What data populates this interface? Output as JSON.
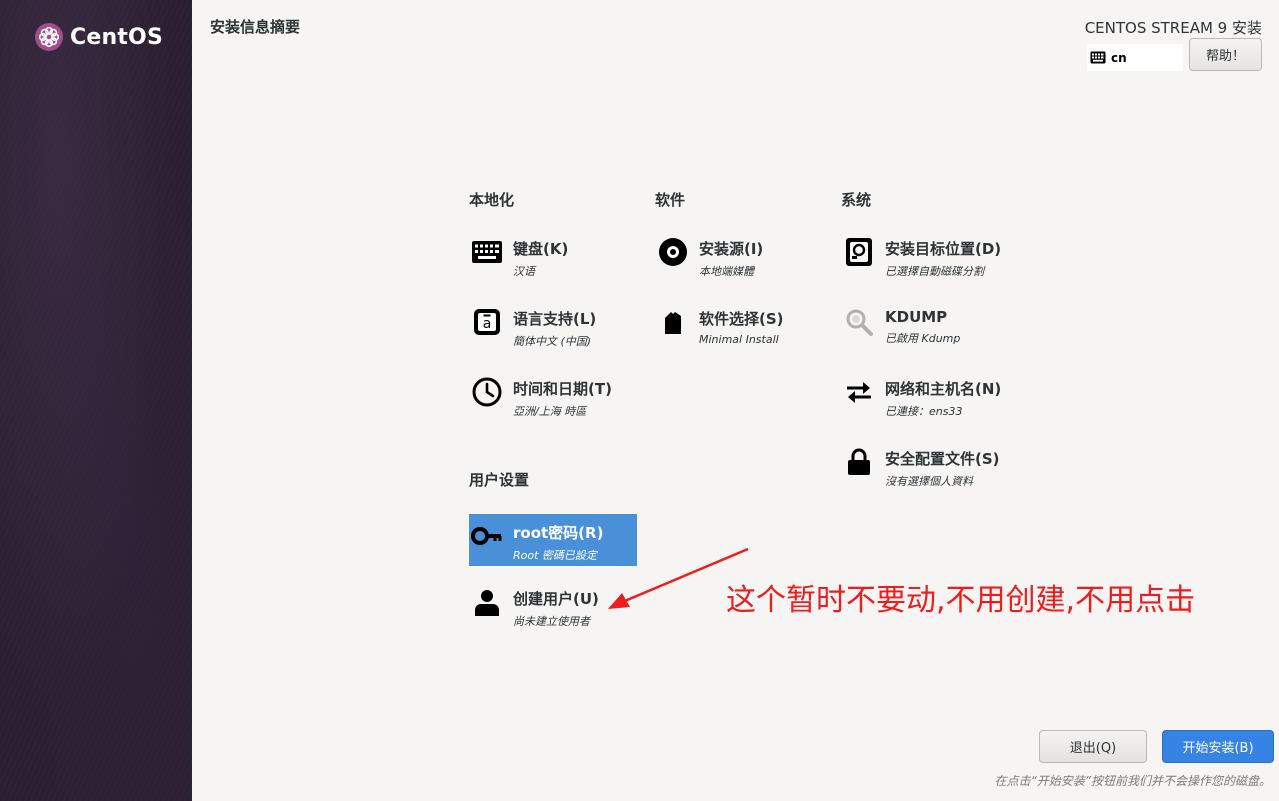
{
  "brand": {
    "name": "CentOS"
  },
  "header": {
    "title": "安装信息摘要",
    "product": "CENTOS STREAM 9 安装",
    "keyboard_layout": "cn",
    "help_label": "帮助！"
  },
  "categories": {
    "localization": {
      "label": "本地化",
      "items": [
        {
          "title": "键盘(K)",
          "status": "汉语",
          "icon": "keyboard-icon"
        },
        {
          "title": "语言支持(L)",
          "status": "簡体中文 (中国)",
          "icon": "language-icon"
        },
        {
          "title": "时间和日期(T)",
          "status": "亞洲/上海 時區",
          "icon": "clock-icon"
        }
      ]
    },
    "software": {
      "label": "软件",
      "items": [
        {
          "title": "安装源(I)",
          "status": "本地端媒體",
          "icon": "disc-icon"
        },
        {
          "title": "软件选择(S)",
          "status": "Minimal Install",
          "icon": "package-icon"
        }
      ]
    },
    "system": {
      "label": "系统",
      "items": [
        {
          "title": "安装目标位置(D)",
          "status": "已選擇自動磁碟分割",
          "icon": "harddisk-icon"
        },
        {
          "title": "KDUMP",
          "status": "已啟用 Kdump",
          "icon": "magnifier-icon"
        },
        {
          "title": "网络和主机名(N)",
          "status": "已連接：ens33",
          "icon": "network-arrows-icon"
        },
        {
          "title": "安全配置文件(S)",
          "status": "沒有選擇個人資料",
          "icon": "lock-icon"
        }
      ]
    },
    "user_settings": {
      "label": "用户设置",
      "items": [
        {
          "title": "root密码(R)",
          "status": "Root 密碼已設定",
          "icon": "key-icon",
          "selected": true
        },
        {
          "title": "创建用户(U)",
          "status": "尚未建立使用者",
          "icon": "user-icon"
        }
      ]
    }
  },
  "annotation": {
    "text": "这个暂时不要动,不用创建,不用点击",
    "color": "#ee1c1c"
  },
  "footer": {
    "quit_label": "退出(Q)",
    "begin_label": "开始安装(B)",
    "note": "在点击“开始安装”按钮前我们并不会操作您的磁盘。"
  },
  "colors": {
    "accent": "#3584e4",
    "selected": "#4a90d9",
    "sidebar": "#2a1f30"
  }
}
